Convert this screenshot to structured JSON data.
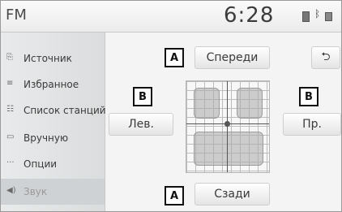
{
  "header": {
    "title": "FM",
    "clock": "6:28"
  },
  "sidebar": {
    "items": [
      {
        "label": "Источник",
        "icon": "source-icon"
      },
      {
        "label": "Избранное",
        "icon": "favorites-icon"
      },
      {
        "label": "Список станций",
        "icon": "station-list-icon"
      },
      {
        "label": "Вручную",
        "icon": "manual-icon"
      },
      {
        "label": "Опции",
        "icon": "options-icon"
      },
      {
        "label": "Звук",
        "icon": "speaker-icon",
        "active": true
      }
    ]
  },
  "main": {
    "front_label": "Спереди",
    "rear_label": "Сзади",
    "left_label": "Лев.",
    "right_label": "Пр.",
    "back_symbol": "⮌",
    "callout_a": "A",
    "callout_b": "B"
  }
}
